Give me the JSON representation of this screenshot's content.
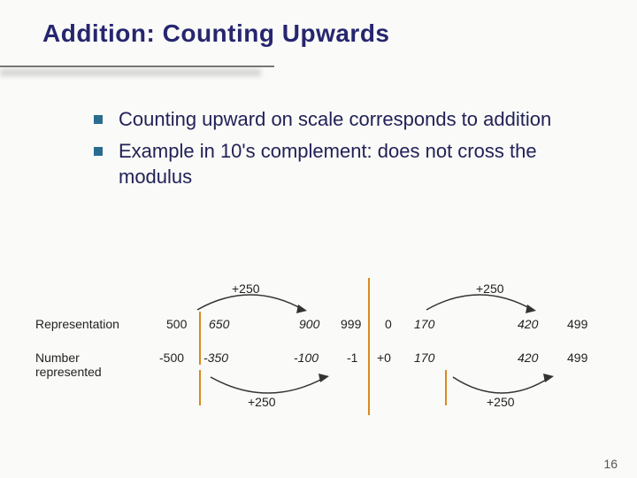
{
  "title": "Addition: Counting Upwards",
  "bullets": [
    "Counting upward on scale corresponds to addition",
    "Example in 10's complement:  does not cross the modulus"
  ],
  "diagram": {
    "top_labels": {
      "left": "+250",
      "right": "+250"
    },
    "bottom_labels": {
      "left": "+250",
      "right": "+250"
    },
    "rows": [
      {
        "label": "Representation",
        "cells": [
          "500",
          "650",
          "900",
          "999",
          "0",
          "170",
          "420",
          "499"
        ]
      },
      {
        "label": "Number represented",
        "cells": [
          "-500",
          "-350",
          "-100",
          "-1",
          "+0",
          "170",
          "420",
          "499"
        ]
      }
    ],
    "italic_cols": [
      1,
      2,
      5,
      6
    ]
  },
  "page_number": "16"
}
